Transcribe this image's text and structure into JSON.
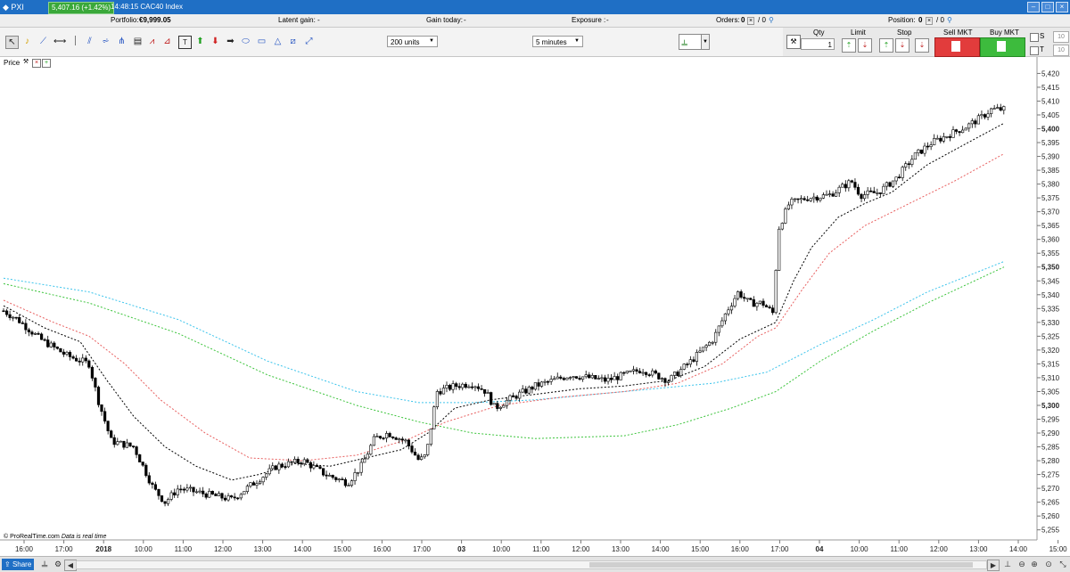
{
  "titlebar": {
    "app": "PXI",
    "price": "5,407.16 (+1.42%)",
    "title": "14:48:15 CAC40 Index"
  },
  "infobar": {
    "portfolio_label": "Portfolio:",
    "portfolio_value": "€9,999.05",
    "latent_label": "Latent gain:",
    "latent_value": "-",
    "gain_label": "Gain today:",
    "gain_value": "-",
    "exposure_label": "Exposure :",
    "exposure_value": "-",
    "orders_label": "Orders:",
    "orders_value": "0",
    "orders_total": "/ 0",
    "position_label": "Position:",
    "position_value": "0",
    "position_total": "/ 0"
  },
  "toolbar": {
    "units": "200 units",
    "timeframe": "5 minutes"
  },
  "order": {
    "qty_label": "Qty",
    "qty_value": "1",
    "limit_label": "Limit",
    "stop_label": "Stop",
    "sell_label": "Sell MKT",
    "buy_label": "Buy MKT",
    "s_label": "S",
    "t_label": "T",
    "s_value": "10",
    "t_value": "10"
  },
  "panel": {
    "price_label": "Price"
  },
  "footer": {
    "share_label": "Share",
    "credit_source": "© ProRealTime.com",
    "credit_realtime": "Data is real time"
  },
  "colors": {
    "ma_black": "#000000",
    "ma_red": "#e86060",
    "ma_cyan": "#3cc4ec",
    "ma_green": "#3cc43c"
  },
  "chart_data": {
    "type": "candlestick",
    "ylim": [
      5252,
      5424
    ],
    "y_ticks": [
      "5,420",
      "5,415",
      "5,410",
      "5,405",
      "5,400",
      "5,395",
      "5,390",
      "5,385",
      "5,380",
      "5,375",
      "5,370",
      "5,365",
      "5,360",
      "5,355",
      "5,350",
      "5,345",
      "5,340",
      "5,335",
      "5,330",
      "5,325",
      "5,320",
      "5,315",
      "5,310",
      "5,305",
      "5,300",
      "5,295",
      "5,290",
      "5,285",
      "5,280",
      "5,275",
      "5,270",
      "5,265",
      "5,260",
      "5,255"
    ],
    "y_ticks_bold": [
      "5,400",
      "5,350",
      "5,300"
    ],
    "x_ticks": [
      "16:00",
      "17:00",
      "2018",
      "10:00",
      "11:00",
      "12:00",
      "13:00",
      "14:00",
      "15:00",
      "16:00",
      "17:00",
      "03",
      "10:00",
      "11:00",
      "12:00",
      "13:00",
      "14:00",
      "15:00",
      "16:00",
      "17:00",
      "04",
      "10:00",
      "11:00",
      "12:00",
      "13:00",
      "14:00",
      "15:00"
    ],
    "x_ticks_bold": [
      "2018",
      "03",
      "04"
    ],
    "price_points": [
      [
        0,
        5335
      ],
      [
        20,
        5331
      ],
      [
        45,
        5324
      ],
      [
        75,
        5318
      ],
      [
        100,
        5315
      ],
      [
        110,
        5302
      ],
      [
        125,
        5287
      ],
      [
        150,
        5285
      ],
      [
        172,
        5270
      ],
      [
        185,
        5265
      ],
      [
        200,
        5270
      ],
      [
        230,
        5268
      ],
      [
        260,
        5266
      ],
      [
        285,
        5272
      ],
      [
        310,
        5278
      ],
      [
        340,
        5280
      ],
      [
        365,
        5275
      ],
      [
        390,
        5272
      ],
      [
        405,
        5278
      ],
      [
        420,
        5288
      ],
      [
        435,
        5290
      ],
      [
        455,
        5287
      ],
      [
        470,
        5280
      ],
      [
        478,
        5282
      ],
      [
        490,
        5305
      ],
      [
        510,
        5307
      ],
      [
        530,
        5308
      ],
      [
        545,
        5305
      ],
      [
        555,
        5299
      ],
      [
        570,
        5302
      ],
      [
        600,
        5307
      ],
      [
        640,
        5311
      ],
      [
        680,
        5309
      ],
      [
        720,
        5313
      ],
      [
        750,
        5309
      ],
      [
        775,
        5316
      ],
      [
        800,
        5324
      ],
      [
        815,
        5334
      ],
      [
        828,
        5341
      ],
      [
        840,
        5337
      ],
      [
        855,
        5337
      ],
      [
        868,
        5333
      ],
      [
        872,
        5363
      ],
      [
        885,
        5373
      ],
      [
        905,
        5375
      ],
      [
        930,
        5376
      ],
      [
        955,
        5381
      ],
      [
        965,
        5376
      ],
      [
        985,
        5377
      ],
      [
        1005,
        5382
      ],
      [
        1025,
        5390
      ],
      [
        1045,
        5395
      ],
      [
        1065,
        5398
      ],
      [
        1085,
        5401
      ],
      [
        1100,
        5404
      ],
      [
        1112,
        5407
      ],
      [
        1126,
        5407
      ]
    ],
    "ma_black": [
      [
        4,
        5336
      ],
      [
        50,
        5328
      ],
      [
        90,
        5323
      ],
      [
        120,
        5309
      ],
      [
        150,
        5296
      ],
      [
        185,
        5285
      ],
      [
        220,
        5278
      ],
      [
        260,
        5273
      ],
      [
        290,
        5275
      ],
      [
        330,
        5279
      ],
      [
        370,
        5278
      ],
      [
        410,
        5281
      ],
      [
        450,
        5284
      ],
      [
        480,
        5290
      ],
      [
        510,
        5299
      ],
      [
        550,
        5302
      ],
      [
        600,
        5304
      ],
      [
        650,
        5306
      ],
      [
        700,
        5307
      ],
      [
        750,
        5309
      ],
      [
        790,
        5314
      ],
      [
        830,
        5324
      ],
      [
        870,
        5330
      ],
      [
        890,
        5345
      ],
      [
        910,
        5357
      ],
      [
        940,
        5368
      ],
      [
        970,
        5373
      ],
      [
        1000,
        5377
      ],
      [
        1040,
        5387
      ],
      [
        1080,
        5394
      ],
      [
        1126,
        5402
      ]
    ],
    "ma_red": [
      [
        4,
        5338
      ],
      [
        60,
        5330
      ],
      [
        100,
        5325
      ],
      [
        140,
        5315
      ],
      [
        180,
        5302
      ],
      [
        230,
        5290
      ],
      [
        280,
        5281
      ],
      [
        340,
        5280
      ],
      [
        400,
        5282
      ],
      [
        460,
        5288
      ],
      [
        500,
        5294
      ],
      [
        560,
        5300
      ],
      [
        630,
        5303
      ],
      [
        700,
        5305
      ],
      [
        760,
        5308
      ],
      [
        810,
        5315
      ],
      [
        850,
        5325
      ],
      [
        870,
        5328
      ],
      [
        900,
        5342
      ],
      [
        930,
        5355
      ],
      [
        970,
        5365
      ],
      [
        1020,
        5373
      ],
      [
        1070,
        5381
      ],
      [
        1126,
        5391
      ]
    ],
    "ma_cyan": [
      [
        4,
        5346
      ],
      [
        100,
        5341
      ],
      [
        200,
        5331
      ],
      [
        300,
        5316
      ],
      [
        400,
        5305
      ],
      [
        470,
        5301
      ],
      [
        530,
        5301
      ],
      [
        600,
        5302
      ],
      [
        700,
        5305
      ],
      [
        800,
        5308
      ],
      [
        860,
        5312
      ],
      [
        920,
        5322
      ],
      [
        980,
        5331
      ],
      [
        1040,
        5341
      ],
      [
        1126,
        5352
      ]
    ],
    "ma_green": [
      [
        4,
        5344
      ],
      [
        100,
        5337
      ],
      [
        200,
        5326
      ],
      [
        300,
        5311
      ],
      [
        400,
        5300
      ],
      [
        470,
        5294
      ],
      [
        530,
        5290
      ],
      [
        600,
        5288
      ],
      [
        700,
        5289
      ],
      [
        760,
        5293
      ],
      [
        820,
        5299
      ],
      [
        870,
        5305
      ],
      [
        920,
        5316
      ],
      [
        980,
        5327
      ],
      [
        1040,
        5337
      ],
      [
        1126,
        5350
      ]
    ]
  }
}
